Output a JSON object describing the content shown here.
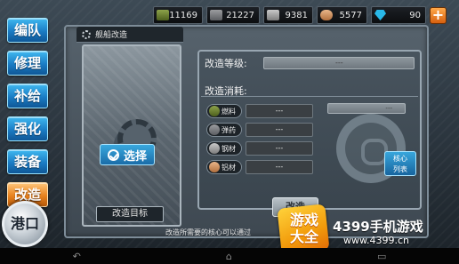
{
  "resources": {
    "fuel": "11169",
    "ammo": "21227",
    "steel": "9381",
    "aluminum": "5577",
    "gems": "90",
    "add_label": "+"
  },
  "side_menu": {
    "items": [
      {
        "label": "编队"
      },
      {
        "label": "修理"
      },
      {
        "label": "补给"
      },
      {
        "label": "强化"
      },
      {
        "label": "装备"
      },
      {
        "label": "改造"
      }
    ],
    "port_label": "港口"
  },
  "panel": {
    "tab_title": "舰船改造",
    "select_label": "选择",
    "target_label": "改造目标",
    "level_label": "改造等级:",
    "level_value": "---",
    "cost_header": "改造消耗:",
    "costs": [
      {
        "name": "燃料",
        "value": "---"
      },
      {
        "name": "弹药",
        "value": "---"
      },
      {
        "name": "钢材",
        "value": "---"
      },
      {
        "name": "铝材",
        "value": "---"
      }
    ],
    "core_value": "---",
    "core_list_line1": "核心",
    "core_list_line2": "列表",
    "modify_label": "改造",
    "tip": "改造所需要的核心可以通过"
  },
  "watermark": {
    "logo_line1": "游戏",
    "logo_line2": "大全",
    "title": "4399手机游戏",
    "url": "www.4399.cn"
  },
  "nav": {
    "back": "↶",
    "home": "⌂",
    "recent": "▭"
  }
}
